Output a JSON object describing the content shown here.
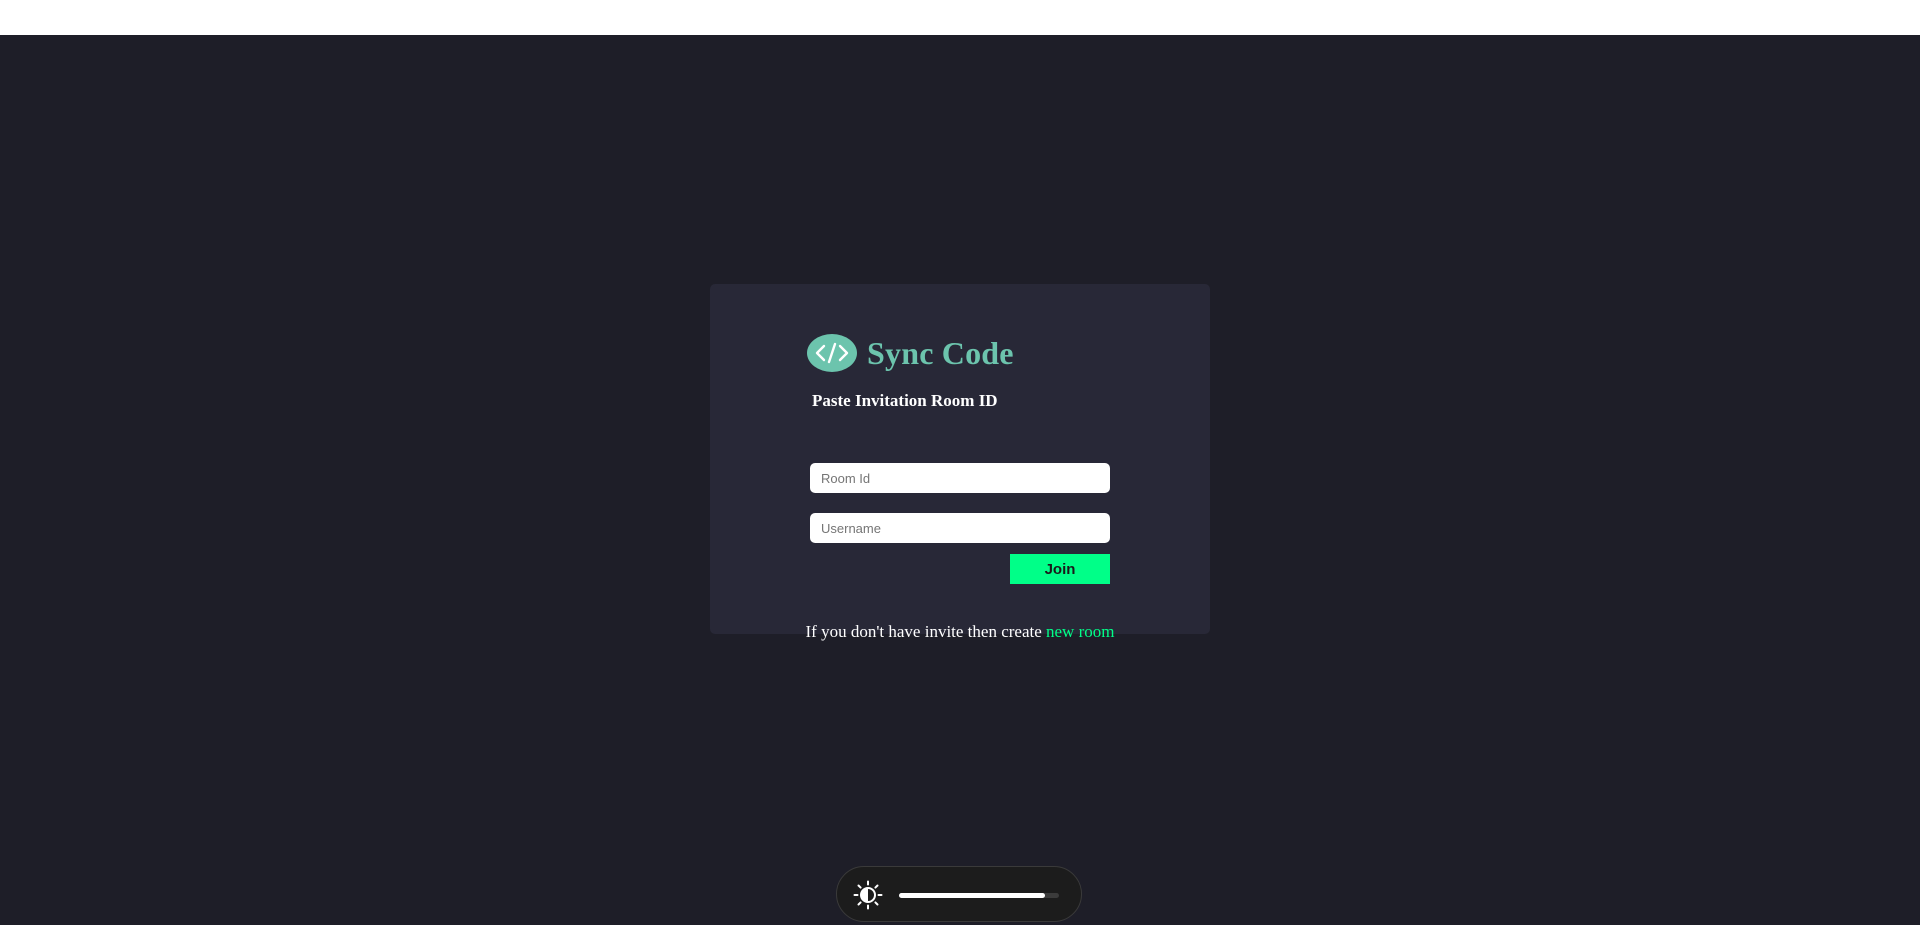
{
  "app": {
    "brand_name": "Sync Code",
    "logo_icon": "code-brackets-icon",
    "heading": "Paste Invitation Room ID",
    "room_id_placeholder": "Room Id",
    "username_placeholder": "Username",
    "join_label": "Join",
    "footer_prefix": "If you don't have invite then create ",
    "new_room_link": "new room"
  },
  "brightness_overlay": {
    "icon": "brightness-icon",
    "level": 0.91
  },
  "colors": {
    "background": "#1e1e28",
    "card": "#282837",
    "accent": "#00ff88",
    "brand": "#6cc4ad"
  }
}
